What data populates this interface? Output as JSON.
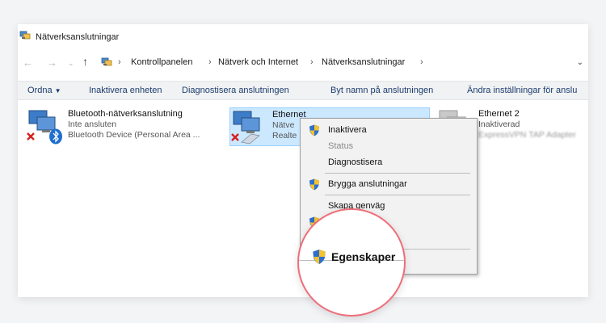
{
  "window": {
    "title": "Nätverksanslutningar"
  },
  "address": {
    "crumbs": [
      "Kontrollpanelen",
      "Nätverk och Internet",
      "Nätverksanslutningar"
    ]
  },
  "toolbar": {
    "organize": "Ordna",
    "disable": "Inaktivera enheten",
    "diagnose": "Diagnostisera anslutningen",
    "rename": "Byt namn på anslutningen",
    "change_settings": "Ändra inställningar för anslu"
  },
  "connections": [
    {
      "name": "Bluetooth-nätverksanslutning",
      "status": "Inte ansluten",
      "device": "Bluetooth Device (Personal Area ..."
    },
    {
      "name": "Ethernet",
      "status": "Nätve",
      "device": "Realte"
    },
    {
      "name": "Ethernet 2",
      "status": "Inaktiverad",
      "device": "ExpressVPN TAP Adapter"
    }
  ],
  "context_menu": {
    "disable": "Inaktivera",
    "status": "Status",
    "diagnose": "Diagnostisera",
    "bridge": "Brygga anslutningar",
    "shortcut": "Skapa genväg",
    "properties": "Egenskaper"
  },
  "colors": {
    "accent": "#1c3d6e",
    "selection": "#cce8ff",
    "highlight_ring": "#ee6e7a"
  }
}
